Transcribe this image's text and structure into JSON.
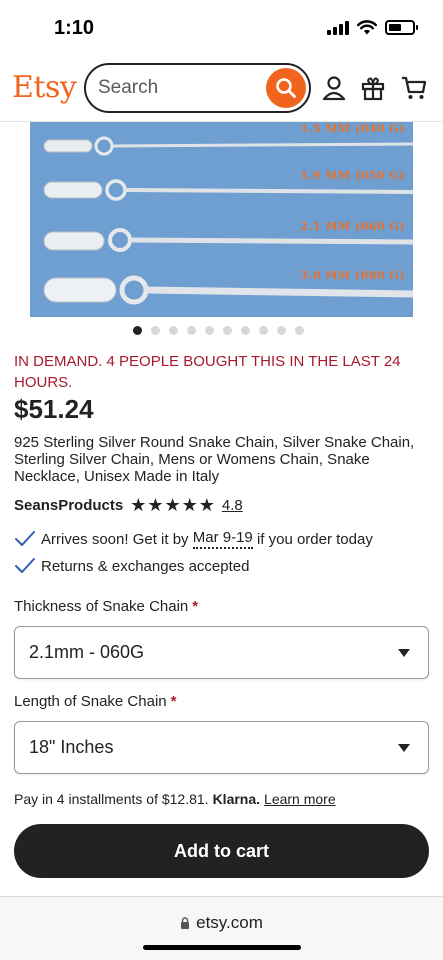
{
  "status_bar": {
    "time": "1:10"
  },
  "header": {
    "logo": "Etsy",
    "search_placeholder": "Search"
  },
  "product_image": {
    "chain_labels": [
      "1.5 MM (040 G)",
      "1.9 MM (050 G)",
      "2.1 MM (060 G)",
      "3.0 MM (080 G)"
    ],
    "carousel_total": 10,
    "carousel_active": 1
  },
  "listing": {
    "demand_text": "IN DEMAND. 4 PEOPLE BOUGHT THIS IN THE LAST 24 HOURS.",
    "price": "$51.24",
    "title": "925 Sterling Silver Round Snake Chain, Silver Snake Chain, Sterling Silver Chain, Mens or Womens Chain, Snake Necklace, Unisex Made in Italy",
    "shop_name": "SeansProducts",
    "rating": "4.8",
    "stars": 5
  },
  "shipping": {
    "arrives_prefix": "Arrives soon! Get it by",
    "arrives_dates": "Mar 9-19",
    "arrives_suffix": "if you order today",
    "returns": "Returns & exchanges accepted"
  },
  "options": {
    "thickness_label": "Thickness of Snake Chain",
    "thickness_value": "2.1mm - 060G",
    "length_label": "Length of Snake Chain",
    "length_value": "18\" Inches",
    "required_marker": "*"
  },
  "payment": {
    "installments_text": "Pay in 4 installments of $12.81.",
    "provider": "Klarna.",
    "learn_more": "Learn more"
  },
  "cta": {
    "add_to_cart": "Add to cart"
  },
  "browser": {
    "url": "etsy.com"
  },
  "colors": {
    "brand": "#f1641e",
    "demand": "#a61a2e",
    "dark": "#222222"
  }
}
